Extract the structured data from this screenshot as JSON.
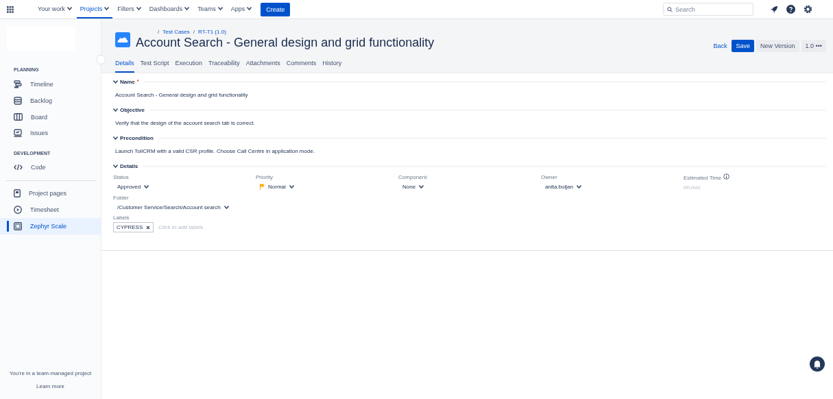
{
  "topnav": {
    "items": [
      {
        "label": "Your work",
        "selected": false
      },
      {
        "label": "Projects",
        "selected": true
      },
      {
        "label": "Filters",
        "selected": false
      },
      {
        "label": "Dashboards",
        "selected": false
      },
      {
        "label": "Teams",
        "selected": false
      },
      {
        "label": "Apps",
        "selected": false
      }
    ],
    "create": "Create",
    "search": {
      "placeholder": "Search"
    }
  },
  "sidebar": {
    "groups": [
      {
        "heading": "PLANNING",
        "items": [
          {
            "label": "Timeline",
            "kind": "timeline",
            "selected": false
          },
          {
            "label": "Backlog",
            "kind": "backlog",
            "selected": false
          },
          {
            "label": "Board",
            "kind": "board",
            "selected": false
          },
          {
            "label": "Issues",
            "kind": "issues",
            "selected": false
          }
        ]
      },
      {
        "heading": "DEVELOPMENT",
        "items": [
          {
            "label": "Code",
            "kind": "code",
            "selected": false
          }
        ]
      },
      {
        "items": [
          {
            "label": "Project pages",
            "kind": "pages",
            "selected": false
          },
          {
            "label": "Timesheet",
            "kind": "timesheet",
            "selected": false
          },
          {
            "label": "Zephyr Scale",
            "kind": "zephyr",
            "selected": true
          }
        ]
      }
    ],
    "footer": "You're in a team-managed project",
    "learn_more": "Learn more"
  },
  "header": {
    "separator": "/",
    "breadcrumbs": [
      "Test Cases",
      "RT-T1 (1.0)"
    ],
    "title": "Account Search - General design and grid functionality",
    "actions": {
      "back": "Back",
      "save": "Save",
      "new_version": "New Version",
      "version": "1.0",
      "more": "•••"
    }
  },
  "tabs": [
    {
      "label": "Details",
      "selected": true
    },
    {
      "label": "Test Script",
      "selected": false
    },
    {
      "label": "Execution",
      "selected": false
    },
    {
      "label": "Traceability",
      "selected": false
    },
    {
      "label": "Attachments",
      "selected": false
    },
    {
      "label": "Comments",
      "selected": false
    },
    {
      "label": "History",
      "selected": false
    }
  ],
  "sections": [
    {
      "kind": "text",
      "title": "Name",
      "required": true,
      "required_mark": "*",
      "text": "Account Search - General design and grid functionality"
    },
    {
      "kind": "text",
      "title": "Objective",
      "required": false,
      "text": "Verify that the design of the account search tab is correct."
    },
    {
      "kind": "text",
      "title": "Precondition",
      "required": false,
      "text": "Launch TollCRM with a valid CSR profile. Choose Call Centre in application mode."
    },
    {
      "kind": "details",
      "title": "Details",
      "required": false,
      "fields": [
        {
          "kind": "select",
          "label": "Status",
          "value": "Approved"
        },
        {
          "kind": "priority",
          "label": "Priority",
          "value": "Normal"
        },
        {
          "kind": "select",
          "label": "Component",
          "value": "None"
        },
        {
          "kind": "select",
          "label": "Owner",
          "value": "anita.buljan"
        },
        {
          "kind": "time",
          "label": "Estimated Time",
          "placeholder": "hh:mm"
        }
      ],
      "folder": {
        "label": "Folder",
        "value": "/Customer Service/Search/Account search"
      },
      "labels": {
        "label": "Labels",
        "tags": [
          "CYPRESS"
        ],
        "placeholder": "Click to add labels"
      }
    }
  ]
}
